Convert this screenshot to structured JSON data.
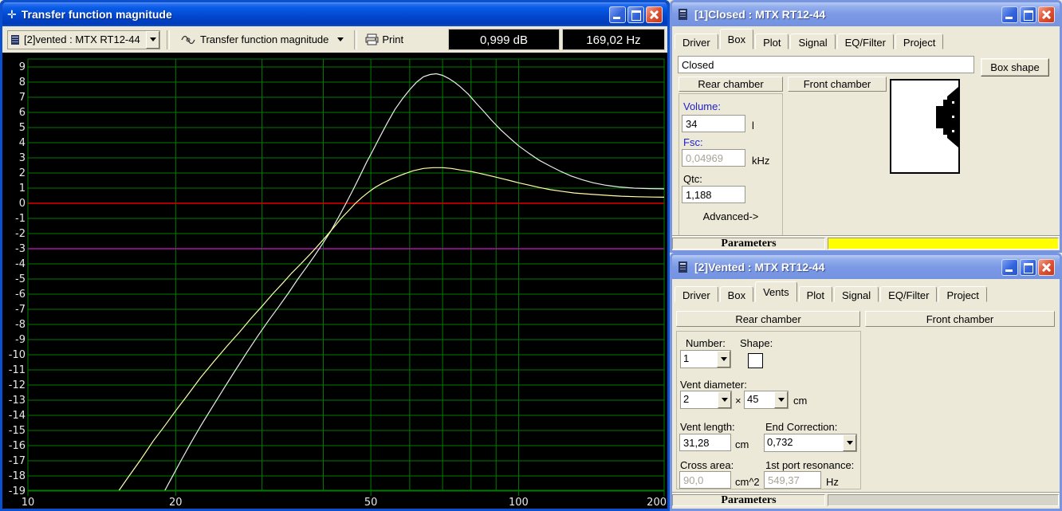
{
  "icons": {
    "plot_title_icon": "✛"
  },
  "plot_window": {
    "title": "Transfer function magnitude",
    "toolbar": {
      "project_selector": "[2]vented : MTX RT12-44",
      "graph_selector": "Transfer function magnitude",
      "print_label": "Print",
      "readout_db": "0,999 dB",
      "readout_hz": "169,02 Hz"
    }
  },
  "chart_data": {
    "type": "line",
    "title": "Transfer function magnitude",
    "xlabel": "",
    "ylabel": "",
    "x_scale": "log",
    "x_range": [
      10,
      200
    ],
    "y_range": [
      -19.5,
      9.5
    ],
    "x_ticks": [
      10,
      20,
      50,
      100,
      200
    ],
    "grid_freqs": [
      20,
      30,
      40,
      50,
      60,
      70,
      80,
      90,
      100
    ],
    "y_grid_step": 1,
    "grid_on": true,
    "background": "#000000",
    "grid_color": "#007d00",
    "axis_text_color": "#e8e8e8",
    "ref_lines": [
      {
        "name": "zero-db-line",
        "db": 0,
        "color": "#dd0000"
      },
      {
        "name": "minus-3db-line",
        "db": -3,
        "color": "#a915a9"
      }
    ],
    "series": [
      {
        "name": "[2]Vented : MTX RT12-44",
        "color": "#e6eee6",
        "points": [
          [
            18.7,
            -19.4
          ],
          [
            19.5,
            -18.3
          ],
          [
            20.5,
            -17.0
          ],
          [
            21.5,
            -15.8
          ],
          [
            22.5,
            -14.7
          ],
          [
            23.5,
            -13.7
          ],
          [
            25,
            -12.3
          ],
          [
            26.5,
            -11.0
          ],
          [
            28,
            -9.8
          ],
          [
            29.5,
            -8.7
          ],
          [
            31,
            -7.7
          ],
          [
            32.5,
            -6.8
          ],
          [
            34,
            -5.9
          ],
          [
            35.5,
            -5.0
          ],
          [
            37,
            -4.2
          ],
          [
            38.5,
            -3.4
          ],
          [
            40,
            -2.6
          ],
          [
            41.5,
            -1.8
          ],
          [
            43,
            -0.9
          ],
          [
            44.5,
            0.0
          ],
          [
            46,
            0.9
          ],
          [
            47.5,
            1.8
          ],
          [
            49,
            2.7
          ],
          [
            50.5,
            3.5
          ],
          [
            52,
            4.3
          ],
          [
            54,
            5.3
          ],
          [
            56,
            6.2
          ],
          [
            58,
            6.9
          ],
          [
            60,
            7.5
          ],
          [
            62,
            8.0
          ],
          [
            64,
            8.35
          ],
          [
            66,
            8.5
          ],
          [
            68,
            8.55
          ],
          [
            70,
            8.45
          ],
          [
            72,
            8.25
          ],
          [
            74,
            8.0
          ],
          [
            76,
            7.7
          ],
          [
            79,
            7.2
          ],
          [
            82,
            6.6
          ],
          [
            85,
            6.05
          ],
          [
            88,
            5.5
          ],
          [
            92,
            4.85
          ],
          [
            96,
            4.3
          ],
          [
            100,
            3.8
          ],
          [
            105,
            3.3
          ],
          [
            110,
            2.85
          ],
          [
            116,
            2.45
          ],
          [
            122,
            2.1
          ],
          [
            128,
            1.8
          ],
          [
            135,
            1.55
          ],
          [
            142,
            1.35
          ],
          [
            150,
            1.2
          ],
          [
            160,
            1.08
          ],
          [
            172,
            1.0
          ],
          [
            185,
            0.97
          ],
          [
            200,
            0.95
          ]
        ]
      },
      {
        "name": "[1]Closed : MTX RT12-44",
        "color": "#ffffa8",
        "points": [
          [
            15,
            -19.4
          ],
          [
            16,
            -18.1
          ],
          [
            17,
            -16.9
          ],
          [
            18,
            -15.7
          ],
          [
            19,
            -14.7
          ],
          [
            20,
            -13.7
          ],
          [
            21,
            -12.8
          ],
          [
            22.5,
            -11.5
          ],
          [
            24,
            -10.4
          ],
          [
            25.5,
            -9.4
          ],
          [
            27,
            -8.5
          ],
          [
            28.5,
            -7.6
          ],
          [
            30,
            -6.8
          ],
          [
            31.5,
            -6.0
          ],
          [
            33,
            -5.3
          ],
          [
            34.5,
            -4.6
          ],
          [
            36,
            -4.0
          ],
          [
            37.5,
            -3.4
          ],
          [
            39,
            -2.8
          ],
          [
            40.5,
            -2.2
          ],
          [
            42,
            -1.6
          ],
          [
            43.5,
            -1.0
          ],
          [
            45,
            -0.5
          ],
          [
            46.5,
            0.0
          ],
          [
            48,
            0.4
          ],
          [
            49.5,
            0.75
          ],
          [
            51,
            1.05
          ],
          [
            53,
            1.35
          ],
          [
            55,
            1.6
          ],
          [
            58,
            1.9
          ],
          [
            61,
            2.15
          ],
          [
            64,
            2.3
          ],
          [
            67,
            2.35
          ],
          [
            70,
            2.35
          ],
          [
            73,
            2.3
          ],
          [
            76,
            2.2
          ],
          [
            80,
            2.1
          ],
          [
            84,
            1.95
          ],
          [
            88,
            1.8
          ],
          [
            92,
            1.65
          ],
          [
            96,
            1.5
          ],
          [
            100,
            1.35
          ],
          [
            105,
            1.2
          ],
          [
            110,
            1.05
          ],
          [
            116,
            0.9
          ],
          [
            122,
            0.8
          ],
          [
            130,
            0.68
          ],
          [
            140,
            0.6
          ],
          [
            150,
            0.53
          ],
          [
            162,
            0.47
          ],
          [
            175,
            0.43
          ],
          [
            188,
            0.41
          ],
          [
            200,
            0.4
          ]
        ]
      }
    ]
  },
  "window1": {
    "title": "[1]Closed : MTX RT12-44",
    "tabs": {
      "items": [
        "Driver",
        "Box",
        "Plot",
        "Signal",
        "EQ/Filter",
        "Project"
      ],
      "active": "Box"
    },
    "box_type_value": "Closed",
    "box_shape_button": "Box shape",
    "rear_chamber": "Rear chamber",
    "front_chamber": "Front chamber",
    "volume_label": "Volume:",
    "volume_value": "34",
    "volume_unit": "l",
    "fsc_label": "Fsc:",
    "fsc_value": "0,04969",
    "fsc_unit": "kHz",
    "qtc_label": "Qtc:",
    "qtc_value": "1,188",
    "advanced_label": "Advanced->",
    "status_left": "Parameters",
    "status_fill": "#ffff00"
  },
  "window2": {
    "title": "[2]Vented : MTX RT12-44",
    "tabs": {
      "items": [
        "Driver",
        "Box",
        "Vents",
        "Plot",
        "Signal",
        "EQ/Filter",
        "Project"
      ],
      "active": "Vents"
    },
    "rear_chamber": "Rear chamber",
    "front_chamber": "Front chamber",
    "number_label": "Number:",
    "number_value": "1",
    "shape_label": "Shape:",
    "vent_diameter_label": "Vent diameter:",
    "vent_width_value": "2",
    "vent_dim_separator": "×",
    "vent_height_value": "45",
    "vent_diameter_unit": "cm",
    "vent_length_label": "Vent length:",
    "vent_length_value": "31,28",
    "vent_length_unit": "cm",
    "end_correction_label": "End Correction:",
    "end_correction_value": "0,732",
    "cross_area_label": "Cross area:",
    "cross_area_value": "90,0",
    "cross_area_unit": "cm^2",
    "port_resonance_label": "1st port resonance:",
    "port_resonance_value": "549,37",
    "port_resonance_unit": "Hz",
    "status_left": "Parameters",
    "status_fill": "#d6d3c8"
  }
}
